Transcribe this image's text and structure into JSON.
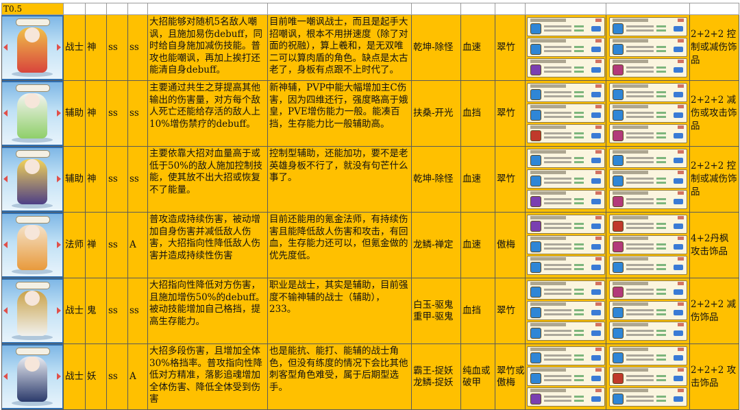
{
  "tier_label": "T0.5",
  "colors": {
    "row_bg": "#ffc000",
    "portrait_bg": "#2f6fb1",
    "grid": "#5a5a5a"
  },
  "rows": [
    {
      "role": "战士",
      "rank": "神",
      "g1": "ss",
      "g2": "ss",
      "skill": "大招能够对随机5名敌人嘲讽，且施加易伤debuff，同时给自身施加减伤技能。普攻也能嘲讽，再加上挨打还能清自身debuff。",
      "comment": "目前唯一嘲讽战士，而且是起手大招嘲讽，根本不用拼速度（除了对面的祝融），算上羲和，是无双唯二可以算肉盾的角色。缺点是太古老了，身板有点跟不上时代了。",
      "skill_set": "乾坤-除怪",
      "stat": "血速",
      "crystal": "翠竹",
      "gear": "2+2+2 控制或减伤饰品",
      "gem_colors": [
        "#2f86d6",
        "#2f86d6",
        "#7a3fb1",
        "#2f86d6",
        "#2f86d6",
        "#b23a7a"
      ],
      "portrait_colors": [
        "#d8453c",
        "#f0c04a"
      ]
    },
    {
      "role": "辅助",
      "rank": "神",
      "g1": "ss",
      "g2": "ss",
      "skill": "主要通过共生之芽提高其他输出的伤害量，对方每个敌人死亡还能给存活的敌人上10%增伤禁疗的debuff。",
      "comment": "新神辅，PVP中能大幅增加主C伤害，因为四维还行，强度略高于娥皇，PVE增伤能力一般。能凑百挡，生存能力比一般辅助高。",
      "skill_set": "扶桑-开光",
      "stat": "血挡",
      "crystal": "翠竹",
      "gear": "2+2+2 减伤或攻击饰品",
      "gem_colors": [
        "#2f86d6",
        "#2f86d6",
        "#c0392b",
        "#2f86d6",
        "#2f86d6",
        "#b23a7a"
      ],
      "portrait_colors": [
        "#8fcf6a",
        "#f3f3ef"
      ]
    },
    {
      "role": "辅助",
      "rank": "神",
      "g1": "ss",
      "g2": "ss",
      "skill": "主要依靠大招对血量高于或低于50%的敌人施加控制技能，使其放不出大招或恢复不了能量。",
      "comment": "控制型辅助，还能加功，要不是老英雄身板不行了，就没有句芒什么事了。",
      "skill_set": "乾坤-除怪",
      "stat": "血速",
      "crystal": "翠竹",
      "gear": "2+2+2 控制或减伤饰品",
      "gem_colors": [
        "#2f86d6",
        "#2f86d6",
        "#7a3fb1",
        "#2f86d6",
        "#2f86d6",
        "#b23a7a"
      ],
      "portrait_colors": [
        "#4d3f86",
        "#f2d35a"
      ]
    },
    {
      "role": "法师",
      "rank": "禅",
      "g1": "ss",
      "g2": "A",
      "skill": "普攻造成持续伤害，被动增加自身伤害并减低敌人伤害，大招指向性降低敌人伤害并造成持续性伤害",
      "comment": "目前还能用的氪金法师，有持续伤害且能降低敌人伤害和攻击，有回血，生存能力还可以，但氪金做的优先度低。",
      "skill_set": "龙鳞-禅定",
      "stat": "血速",
      "crystal": "傲梅",
      "gear": "4+2丹枫 攻击饰品",
      "gem_colors": [
        "#7a3fb1",
        "#2f86d6",
        "#2f86d6",
        "#c0392b",
        "#b23a7a",
        "#2f86d6"
      ],
      "portrait_colors": [
        "#e89a3c",
        "#f4e2c8"
      ]
    },
    {
      "role": "战士",
      "rank": "鬼",
      "g1": "ss",
      "g2": "ss",
      "skill": "大招指向性降低对方伤害，且施加增伤50%的debuff。被动技能增加自己格挡，提高生存能力。",
      "comment": "职业是战士，其实是辅助，目前强度不输神辅的战士（辅助），233。",
      "skill_set": "白玉-驱鬼\n重甲-驱鬼",
      "stat": "血挡",
      "crystal": "翠竹",
      "gear": "2+2+2 减伤饰品",
      "gem_colors": [
        "#2f86d6",
        "#2f86d6",
        "#2f86d6",
        "#b23a7a",
        "#2f86d6",
        "#2f86d6"
      ],
      "portrait_colors": [
        "#f1f1ee",
        "#c9a24a"
      ]
    },
    {
      "role": "战士",
      "rank": "妖",
      "g1": "ss",
      "g2": "A",
      "skill": "大招多段伤害，且增加全体30%格挡率。普攻指向性降低对方精准，落影追魂增加全体伤害、降低全体受到伤害",
      "comment": "也是能抗、能打、能辅的战士角色，但没有练度的情况下会比其他刺客型角色难受，属于后期型选手。",
      "skill_set": "霸王-捉妖\n龙鳞-捉妖",
      "stat": "纯血或破甲",
      "crystal": "翠竹或傲梅",
      "gear": "2+2+2 攻击饰品",
      "gem_colors": [
        "#2f86d6",
        "#2f86d6",
        "#7a3fb1",
        "#2f86d6",
        "#c0392b",
        "#2f86d6"
      ],
      "portrait_colors": [
        "#2b3a6b",
        "#e9ecf2"
      ]
    }
  ]
}
